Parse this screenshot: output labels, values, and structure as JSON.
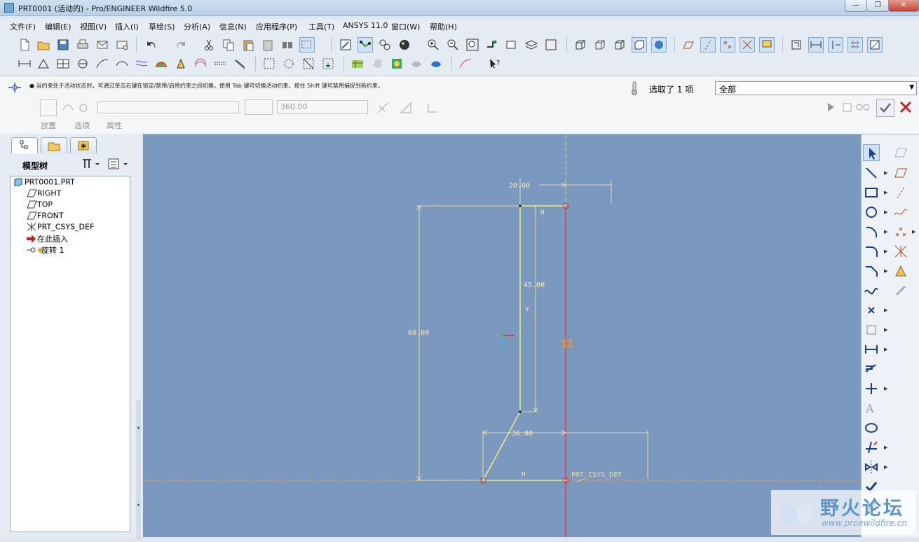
{
  "window": {
    "title": "PRT0001 (活动的) - Pro/ENGINEER Wildfire 5.0",
    "minimize_symbol": "—",
    "restore_symbol": "❐",
    "close_symbol": "✕"
  },
  "menu": {
    "items": [
      "文件(F)",
      "编辑(E)",
      "视图(V)",
      "插入(I)",
      "草绘(S)",
      "分析(A)",
      "信息(N)",
      "应用程序(P)",
      "工具(T)",
      "ANSYS 11.0",
      "窗口(W)",
      "帮助(H)"
    ]
  },
  "dashboard": {
    "status_message": "当约束处于活动状态时，可通过单击右键在锁定/禁用/启用约束之间切换。使用 Tab 键可切换活动约束。按住 Shift 键可禁用捕捉到新约束。",
    "selection_count": "选取了 1 项",
    "filter_value": "全部",
    "angle_value": "360.00",
    "tabs": [
      "放置",
      "选项",
      "属性"
    ]
  },
  "model_tree": {
    "title": "模型树",
    "items": [
      "PRT0001.PRT",
      "RIGHT",
      "TOP",
      "FRONT",
      "PRT_CSYS_DEF",
      "在此插入",
      "旋转 1"
    ]
  },
  "sketch": {
    "dimensions": {
      "top_width": "20.00",
      "height_upper": "45.00",
      "height_total": "60.00",
      "bottom_width": "36.00"
    },
    "constraints": {
      "horizontal_top": "H",
      "vertical": "V",
      "horizontal_bottom": "H",
      "parallel": "II"
    },
    "csys_label": "PRT_CSYS_DEF"
  },
  "watermark": {
    "title": "野火论坛",
    "url": "www.proewildfire.cn"
  },
  "colors": {
    "canvas_bg": "#7b99bf",
    "sketch_line": "#ffff7a",
    "dimension": "#ffe9a8",
    "centerline": "#e8d04a",
    "axis_red": "#e03030"
  }
}
